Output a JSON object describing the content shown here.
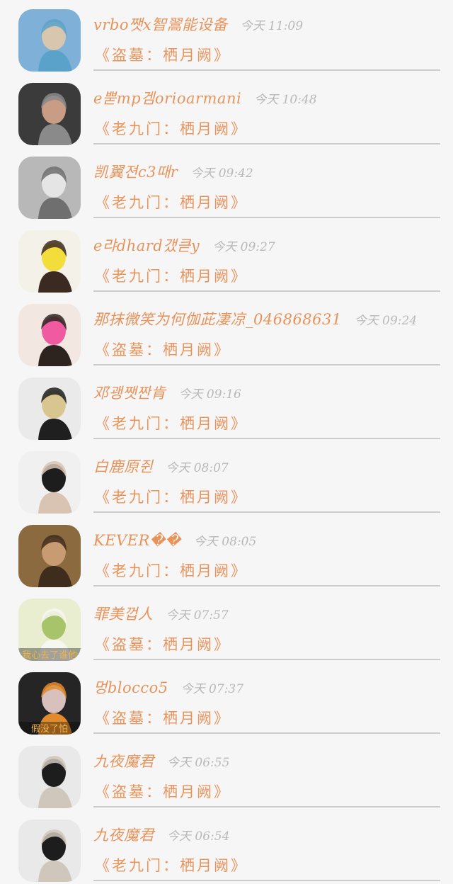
{
  "messages": [
    {
      "sender": "vrbo쨋x智翯能设备",
      "time": "今天 11:09",
      "preview": "《盗墓：栖月阙》",
      "avatar": "avatar-yoga-woman",
      "colors": [
        "#7fb0d8",
        "#d9c6ae",
        "#5aa2c9"
      ]
    },
    {
      "sender": "e뿓mp겜orioarmani",
      "time": "今天 10:48",
      "preview": "《老九门：栖月阙》",
      "avatar": "avatar-woman-soccer",
      "colors": [
        "#3b3b3b",
        "#c99c86",
        "#8a8a8a"
      ]
    },
    {
      "sender": "凯翼젼c3때r",
      "time": "今天 09:42",
      "preview": "《老九门：栖月阙》",
      "avatar": "avatar-bw-woman",
      "colors": [
        "#b8b8b8",
        "#e5e5e5",
        "#6f6f6f"
      ]
    },
    {
      "sender": "e랴dhard갰큳y",
      "time": "今天 09:27",
      "preview": "《老九门：栖月阙》",
      "avatar": "avatar-yellow-woman",
      "colors": [
        "#f4f1e9",
        "#f2dd3a",
        "#3b2a22"
      ]
    },
    {
      "sender": "那抹微笑为何伽茈凄凉_046868631",
      "time": "今天 09:24",
      "preview": "《盗墓：栖月阙》",
      "avatar": "avatar-pink-girl",
      "colors": [
        "#f2e7e1",
        "#ef5aa0",
        "#2d2420"
      ]
    },
    {
      "sender": "邓괭쨋짠肯",
      "time": "今天 09:16",
      "preview": "《老九门：栖月阙》",
      "avatar": "avatar-sunglasses-man",
      "colors": [
        "#eaeaea",
        "#d8c590",
        "#1f1f1f"
      ]
    },
    {
      "sender": "白鹿原쥔",
      "time": "今天 08:07",
      "preview": "《老九门：栖月阙》",
      "avatar": "avatar-dark-hair-boy",
      "colors": [
        "#f0f0f0",
        "#1d1d1d",
        "#d9c4b4"
      ]
    },
    {
      "sender": "KEVER��",
      "time": "今天 08:05",
      "preview": "《老九门：栖月阙》",
      "avatar": "avatar-painting-child",
      "colors": [
        "#8a6a3e",
        "#c89b72",
        "#3e2d1c"
      ]
    },
    {
      "sender": "罪美껍人",
      "time": "今天 07:57",
      "preview": "《盗墓：栖月阙》",
      "avatar": "avatar-girl-in-field",
      "colors": [
        "#e9eed1",
        "#a8c46a",
        "#f7f7f2"
      ]
    },
    {
      "sender": "멍blocco5",
      "time": "今天 07:37",
      "preview": "《盗墓：栖月阙》",
      "avatar": "avatar-girl-caption",
      "colors": [
        "#252525",
        "#d8c1bc",
        "#e28b2d"
      ]
    },
    {
      "sender": "九夜魔君",
      "time": "今天 06:55",
      "preview": "《盗墓：栖月阙》",
      "avatar": "avatar-mirror-selfie",
      "colors": [
        "#e9e9e9",
        "#1d1d1d",
        "#cfc7bb"
      ]
    },
    {
      "sender": "九夜魔君",
      "time": "今天 06:54",
      "preview": "《老九门：栖月阙》",
      "avatar": "avatar-mirror-selfie",
      "colors": [
        "#e9e9e9",
        "#1d1d1d",
        "#cfc7bb"
      ]
    }
  ],
  "avatar_captions": {
    "8": "我心去了谁他",
    "9": "假没了怕"
  }
}
